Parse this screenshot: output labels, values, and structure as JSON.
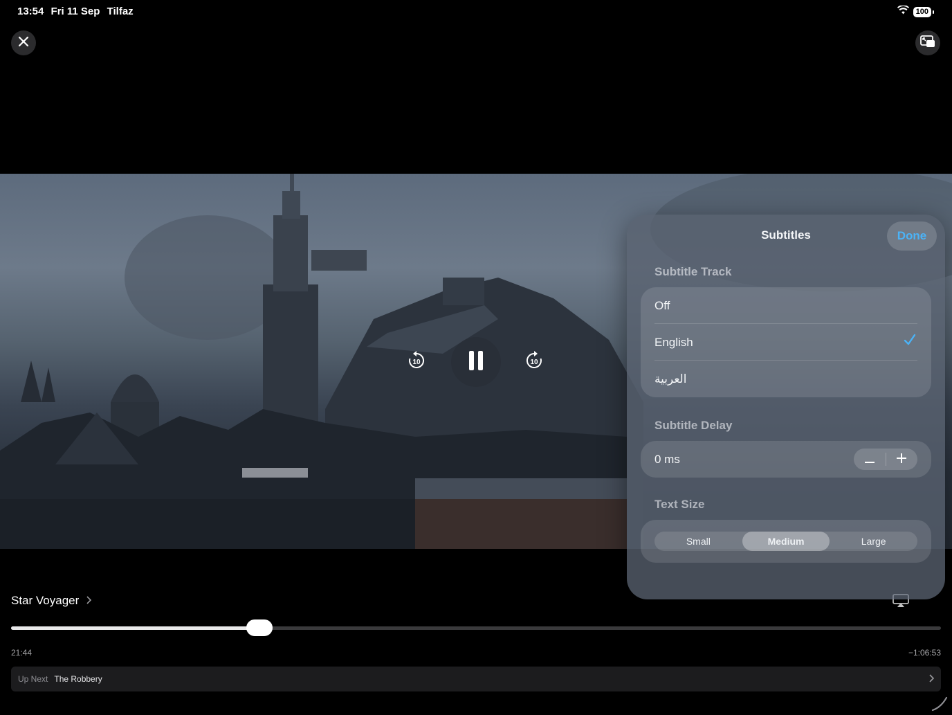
{
  "status_bar": {
    "time": "13:54",
    "date": "Fri 11 Sep",
    "app": "Tilfaz",
    "battery": "100"
  },
  "icons": {
    "close": "close-icon",
    "pip": "picture-in-picture-icon",
    "skip_back": "skip-back-10-icon",
    "pause": "pause-icon",
    "skip_forward": "skip-forward-10-icon",
    "airplay": "airplay-icon"
  },
  "skip": {
    "back": "10",
    "forward": "10"
  },
  "subtitles_panel": {
    "title": "Subtitles",
    "done_label": "Done",
    "track_label": "Subtitle Track",
    "tracks": [
      {
        "label": "Off",
        "selected": false
      },
      {
        "label": "English",
        "selected": true
      },
      {
        "label": "العربية",
        "selected": false
      }
    ],
    "delay_label": "Subtitle Delay",
    "delay_value": "0 ms",
    "text_size_label": "Text Size",
    "text_sizes": [
      {
        "label": "Small",
        "selected": false
      },
      {
        "label": "Medium",
        "selected": true
      },
      {
        "label": "Large",
        "selected": false
      }
    ]
  },
  "player": {
    "title": "Star Voyager",
    "progress": 0.267,
    "elapsed": "21:44",
    "remaining": "−1:06:53",
    "up_next_label": "Up Next",
    "up_next_title": "The Robbery"
  },
  "colors": {
    "accent": "#4bb3f7",
    "background": "#000000"
  }
}
